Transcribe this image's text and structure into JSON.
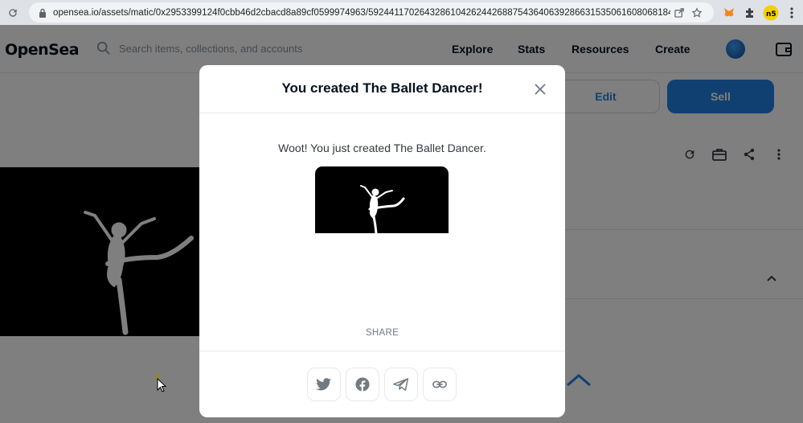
{
  "browser": {
    "url": "opensea.io/assets/matic/0x2953399124f0cbb46d2cbacd8a89cf0599974963/59244117026432861042624426887543640639286631535061608068184..."
  },
  "nav": {
    "logo": "OpenSea",
    "search_placeholder": "Search items, collections, and accounts",
    "links": [
      "Explore",
      "Stats",
      "Resources",
      "Create"
    ]
  },
  "page": {
    "edit_label": "Edit",
    "sell_label": "Sell"
  },
  "modal": {
    "title": "You created The Ballet Dancer!",
    "message": "Woot! You just created The Ballet Dancer.",
    "share_label": "SHARE",
    "share_buttons": [
      "twitter-icon",
      "facebook-icon",
      "telegram-icon",
      "link-icon"
    ]
  },
  "colors": {
    "accent": "#2081e2",
    "text_dark": "#04111d"
  }
}
